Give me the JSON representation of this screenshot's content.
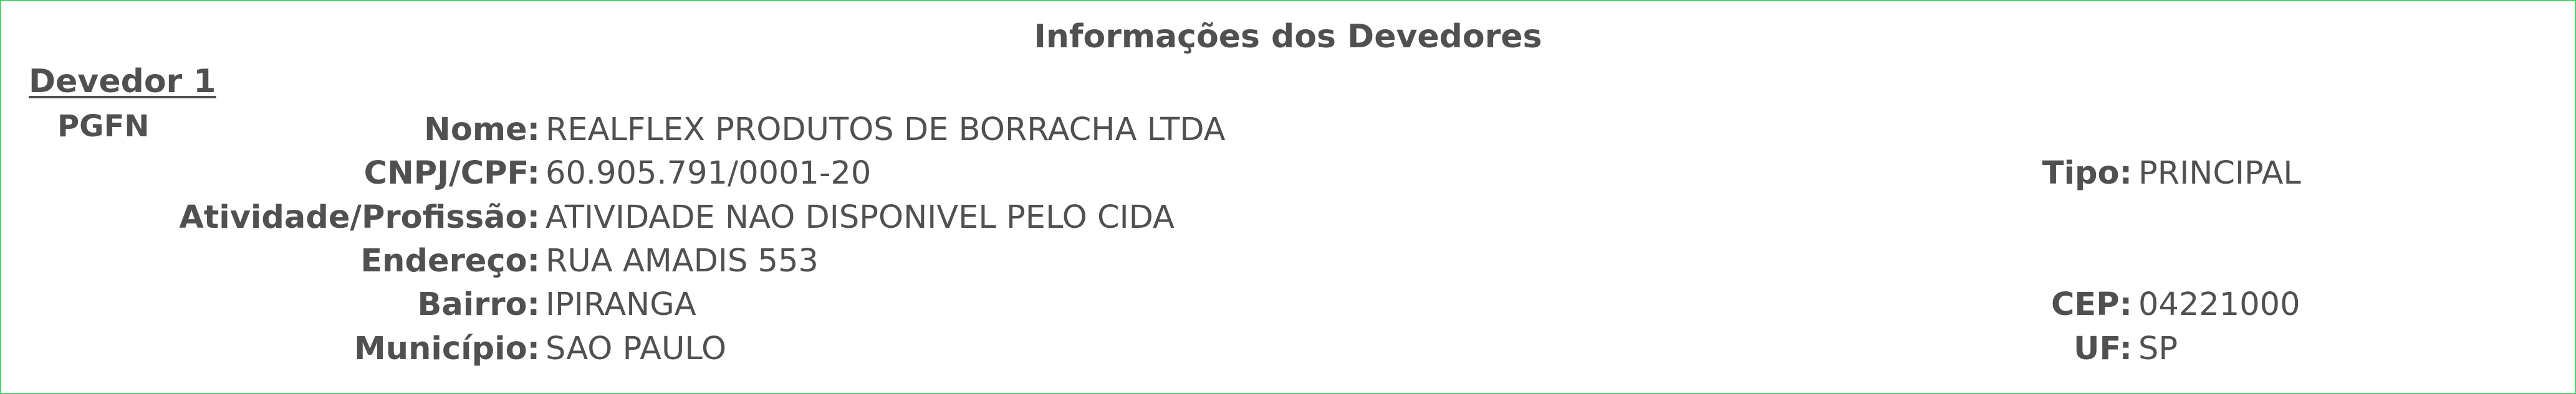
{
  "section_title": "Informações dos Devedores",
  "debtor": {
    "heading": "Devedor 1",
    "origin": "PGFN",
    "fields": {
      "nome_label": "Nome:",
      "nome_value": "REALFLEX PRODUTOS DE BORRACHA LTDA",
      "cnpj_label": "CNPJ/CPF:",
      "cnpj_value": "60.905.791/0001-20",
      "tipo_label": "Tipo:",
      "tipo_value": "PRINCIPAL",
      "atividade_label": "Atividade/Profissão:",
      "atividade_value": "ATIVIDADE NAO DISPONIVEL PELO CIDA",
      "endereco_label": "Endereço:",
      "endereco_value": "RUA AMADIS 553",
      "bairro_label": "Bairro:",
      "bairro_value": "IPIRANGA",
      "cep_label": "CEP:",
      "cep_value": "04221000",
      "municipio_label": "Município:",
      "municipio_value": "SAO PAULO",
      "uf_label": "UF:",
      "uf_value": "SP"
    }
  }
}
